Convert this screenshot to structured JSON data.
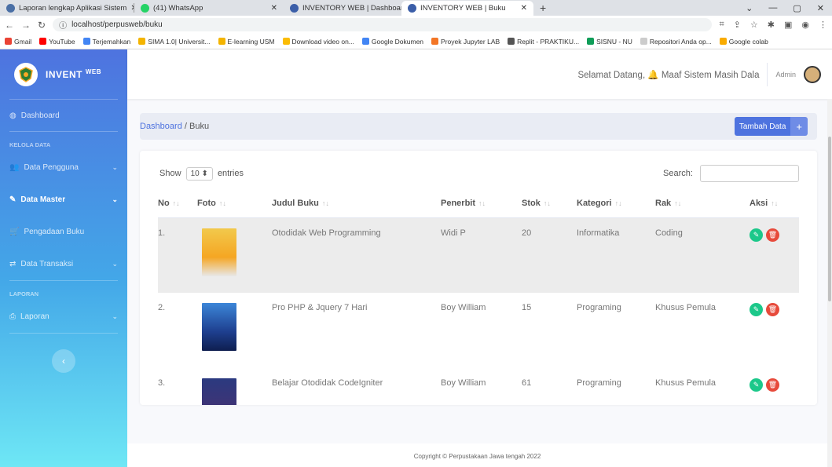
{
  "browser": {
    "tabs": [
      {
        "title": "Laporan lengkap Aplikasi Sistem",
        "icon_color": "#4a6fa5"
      },
      {
        "title": "(41) WhatsApp",
        "icon_color": "#25d366"
      },
      {
        "title": "INVENTORY WEB | Dashboard",
        "icon_color": "#3b5ea8"
      },
      {
        "title": "INVENTORY WEB | Buku",
        "icon_color": "#3b5ea8"
      }
    ],
    "url": "localhost/perpusweb/buku",
    "bookmarks": [
      "Gmail",
      "YouTube",
      "Terjemahkan",
      "SIMA 1.0| Universit...",
      "E-learning USM",
      "Download video on...",
      "Google Dokumen",
      "Proyek Jupyter LAB",
      "Replit - PRAKTIKU...",
      "SISNU - NU",
      "Repositori Anda op...",
      "Google colab"
    ]
  },
  "sidebar": {
    "brand": "INVENT",
    "brand_sup": "WEB",
    "dashboard": "Dashboard",
    "head_kelola": "KELOLA DATA",
    "pengguna": "Data Pengguna",
    "master": "Data Master",
    "pengadaan": "Pengadaan Buku",
    "transaksi": "Data Transaksi",
    "head_laporan": "LAPORAN",
    "laporan": "Laporan"
  },
  "topbar": {
    "welcome": "Selamat Datang, 🔔 Maaf Sistem Masih Dala",
    "admin": "Admin"
  },
  "crumb": {
    "root": "Dashboard",
    "sep": " / ",
    "current": "Buku"
  },
  "add_button": "Tambah Data",
  "table_controls": {
    "show": "Show",
    "entries_value": "10 ⬍",
    "entries": "entries",
    "search": "Search:"
  },
  "columns": [
    "No",
    "Foto",
    "Judul Buku",
    "Penerbit",
    "Stok",
    "Kategori",
    "Rak",
    "Aksi"
  ],
  "rows": [
    {
      "no": "1.",
      "judul": "Otodidak Web Programming",
      "penerbit": "Widi P",
      "stok": "20",
      "kategori": "Informatika",
      "rak": "Coding",
      "cover": "#f2c94c"
    },
    {
      "no": "2.",
      "judul": "Pro PHP & Jquery 7 Hari",
      "penerbit": "Boy William",
      "stok": "15",
      "kategori": "Programing",
      "rak": "Khusus Pemula",
      "cover": "#2f5fb7"
    },
    {
      "no": "3.",
      "judul": "Belajar Otodidak CodeIgniter",
      "penerbit": "Boy William",
      "stok": "61",
      "kategori": "Programing",
      "rak": "Khusus Pemula",
      "cover": "#2b3a80"
    }
  ],
  "footer": "Copyright © Perpustakaan Jawa tengah 2022"
}
